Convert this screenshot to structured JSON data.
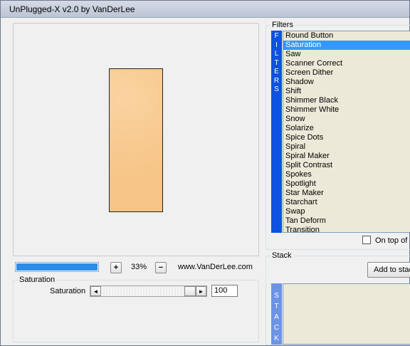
{
  "window": {
    "title": "UnPlugged-X v2.0 by VanDerLee"
  },
  "preview": {
    "progress_fraction": 1.0,
    "zoom_in_label": "+",
    "zoom_level": "33%",
    "zoom_out_label": "−",
    "site_link": "www.VanDerLee.com"
  },
  "params": {
    "group_label": "Saturation",
    "slider_label": "Saturation",
    "slider_value": "100",
    "slider_fraction": 1.0,
    "left_arrow": "◄",
    "right_arrow": "►"
  },
  "filters": {
    "group_label": "Filters",
    "side_letters": [
      "F",
      "I",
      "L",
      "T",
      "E",
      "R",
      "S"
    ],
    "items": [
      "Round Button",
      "Saturation",
      "Saw",
      "Scanner Correct",
      "Screen Dither",
      "Shadow",
      "Shift",
      "Shimmer Black",
      "Shimmer White",
      "Snow",
      "Solarize",
      "Spice Dots",
      "Spiral",
      "Spiral Maker",
      "Split Contrast",
      "Spokes",
      "Spotlight",
      "Star Maker",
      "Starchart",
      "Swap",
      "Tan Deform",
      "Transition"
    ],
    "selected": "Saturation",
    "on_top_label": "On top of"
  },
  "stack": {
    "group_label": "Stack",
    "add_button": "Add to stack",
    "side_letters": [
      "S",
      "T",
      "A",
      "C",
      "K"
    ]
  },
  "colors": {
    "accent": "#0d52e0",
    "selection": "#3399ff",
    "progress": "#2c8de6",
    "preview_fill": "#f8c88c"
  }
}
